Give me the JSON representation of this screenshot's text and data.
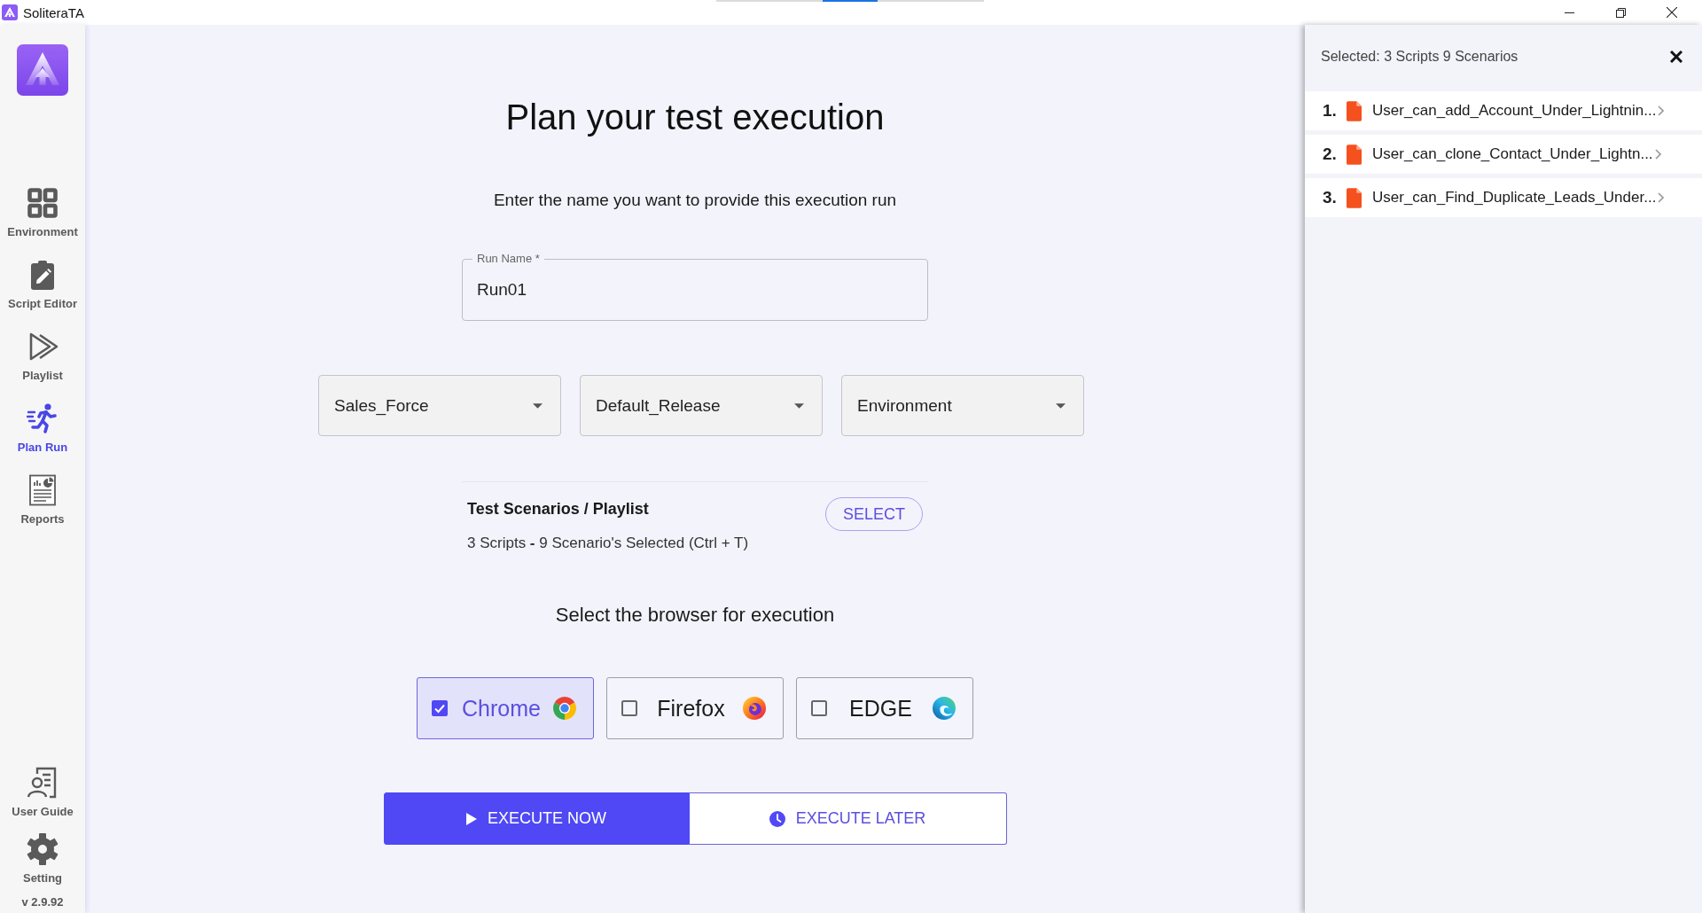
{
  "window": {
    "title": "SoliteraTA"
  },
  "sidebar": {
    "items": [
      {
        "label": "Environment",
        "kind": "environment",
        "selected": false
      },
      {
        "label": "Script Editor",
        "kind": "editor",
        "selected": false
      },
      {
        "label": "Playlist",
        "kind": "playlist",
        "selected": false
      },
      {
        "label": "Plan Run",
        "kind": "run",
        "selected": true
      },
      {
        "label": "Reports",
        "kind": "reports",
        "selected": false
      }
    ],
    "bottom_items": [
      {
        "label": "User Guide",
        "kind": "guide"
      },
      {
        "label": "Setting",
        "kind": "setting"
      }
    ],
    "version": "v 2.9.92"
  },
  "main": {
    "title": "Plan your test execution",
    "prompt": "Enter the name you want to provide this execution run",
    "run_name": {
      "label": "Run Name *",
      "value": "Run01"
    },
    "dropdowns": [
      {
        "value": "Sales_Force"
      },
      {
        "value": "Default_Release"
      },
      {
        "value": "Environment"
      }
    ],
    "scenarios": {
      "heading": "Test Scenarios / Playlist",
      "summary": "3 Scripts **-** 9 Scenario's Selected (Ctrl + T)",
      "button": "SELECT"
    },
    "browser_prompt": "Select the browser for execution",
    "browsers": [
      {
        "label": "Chrome",
        "kind": "chrome",
        "checked": true
      },
      {
        "label": "Firefox",
        "kind": "firefox",
        "checked": false
      },
      {
        "label": "EDGE",
        "kind": "edge",
        "checked": false
      }
    ],
    "actions": [
      {
        "label": "EXECUTE NOW",
        "kind": "primary"
      },
      {
        "label": "EXECUTE LATER",
        "kind": "secondary"
      }
    ]
  },
  "selection_panel": {
    "title": "Selected: 3 Scripts 9 Scenarios",
    "items": [
      {
        "number": "1.",
        "name": "User_can_add_Account_Under_Lightnin..."
      },
      {
        "number": "2.",
        "name": "User_can_clone_Contact_Under_Lightn..."
      },
      {
        "number": "3.",
        "name": "User_can_Find_Duplicate_Leads_Under..."
      }
    ]
  }
}
